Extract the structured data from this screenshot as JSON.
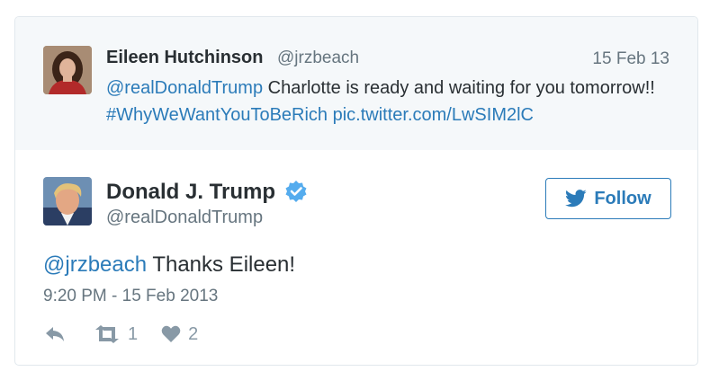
{
  "parent_tweet": {
    "name": "Eileen Hutchinson",
    "handle": "@jrzbeach",
    "date": "15 Feb 13",
    "mention": "@realDonaldTrump",
    "text_line": " Charlotte is ready and waiting for you tomorrow!! ",
    "hashtag": "#WhyWeWantYouToBeRich",
    "link": "pic.twitter.com/LwSIM2lC"
  },
  "tweet": {
    "name": "Donald J. Trump",
    "handle": "@realDonaldTrump",
    "verified_icon": "verified-badge",
    "follow_label": "Follow",
    "mention": "@jrzbeach",
    "text": " Thanks Eileen!",
    "timestamp": "9:20 PM - 15 Feb 2013",
    "retweet_count": "1",
    "like_count": "2"
  },
  "colors": {
    "link": "#2b7bb9",
    "muted": "#66757f",
    "icon": "#8899a6",
    "parent_bg": "#f5f8fa",
    "border": "#e1e8ed"
  },
  "icons": [
    "reply-icon",
    "retweet-icon",
    "heart-icon",
    "twitter-bird-icon"
  ]
}
